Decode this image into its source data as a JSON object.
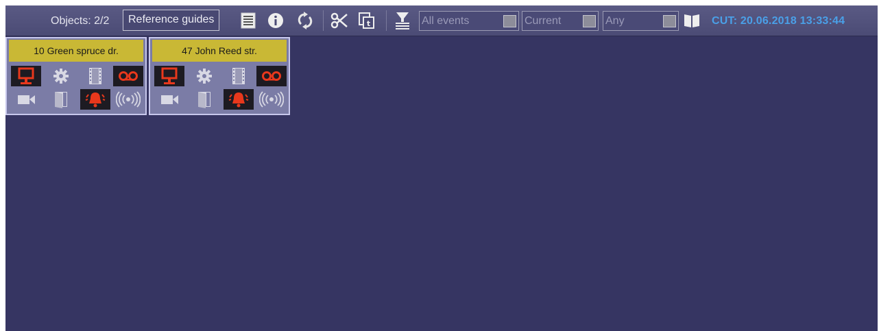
{
  "toolbar": {
    "objects_label": "Objects: 2/2",
    "reference_guides_label": "Reference guides",
    "filters": [
      {
        "text": "All events"
      },
      {
        "text": "Current"
      },
      {
        "text": "Any"
      }
    ],
    "cut_label": "CUT: 20.06.2018 13:33:44",
    "icons": [
      "list-icon",
      "info-icon",
      "refresh-icon",
      "scissors-icon",
      "copy-icon",
      "filter-icon",
      "book-icon"
    ]
  },
  "objects": [
    {
      "name": "10 Green spruce dr.",
      "status_icons": [
        "computer-alarm-icon",
        "settings-icon",
        "film-icon",
        "voicemail-alarm-icon",
        "camera-icon",
        "door-icon",
        "bell-alarm-icon",
        "radio-wave-icon"
      ]
    },
    {
      "name": "47 John Reed str.",
      "status_icons": [
        "computer-alarm-icon",
        "settings-icon",
        "film-icon",
        "voicemail-alarm-icon",
        "camera-icon",
        "door-icon",
        "bell-alarm-icon",
        "radio-wave-icon"
      ]
    }
  ],
  "colors": {
    "background": "#363562",
    "card_title": "#c9b835",
    "alarm_red": "#e8381c",
    "cut_text": "#4aa0e8"
  }
}
